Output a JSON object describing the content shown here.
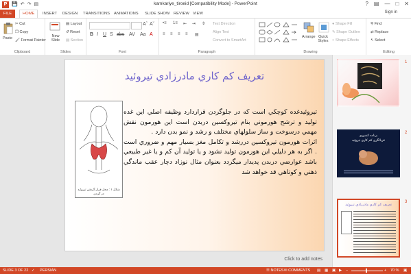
{
  "window": {
    "title": "kamkariye_tiroeid [Compatibility Mode] - PowerPoint"
  },
  "tabs": [
    "FILE",
    "HOME",
    "INSERT",
    "DESIGN",
    "TRANSITIONS",
    "ANIMATIONS",
    "SLIDE SHOW",
    "REVIEW",
    "VIEW"
  ],
  "account": {
    "sign_in": "Sign in"
  },
  "ribbon": {
    "clipboard": {
      "paste": "Paste",
      "cut": "Cut",
      "copy": "Copy",
      "format_painter": "Format Painter",
      "label": "Clipboard"
    },
    "slides": {
      "new_slide": "New Slide",
      "layout": "Layout",
      "reset": "Reset",
      "section": "Section",
      "label": "Slides"
    },
    "font": {
      "label": "Font"
    },
    "paragraph": {
      "text_direction": "Text Direction",
      "align_text": "Align Text",
      "convert_smartart": "Convert to SmartArt",
      "label": "Paragraph"
    },
    "drawing": {
      "arrange": "Arrange",
      "quick_styles": "Quick Styles",
      "shape_fill": "Shape Fill",
      "shape_outline": "Shape Outline",
      "shape_effects": "Shape Effects",
      "label": "Drawing"
    },
    "editing": {
      "find": "Find",
      "replace": "Replace",
      "select": "Select",
      "label": "Editing"
    }
  },
  "slide": {
    "title": "تعريف كم كاري مادرزادي تيروئيد",
    "para1": "تيروئيدغده كوچكي است كه در جلوگردن قراردارد وظيفه اصلي اين غده توليد و ترشح هورموني بنام تيروكسين دربدن است اين هورمون نقش مهمي درسوخت و ساز سلولهاي مختلف و رشد و نمو بدن دارد .",
    "para2": "اثرات هورمون تيروكسين دررشد و تكامل مغز بسيار مهم و ضروري است . اگر به هر دليلي اين هورمون توليد نشود و يا توليد آن كم و يا غير طبيعي باشد عوارضي دربدن پديدار ميگردد بعنوان مثال نوزاد دچار عقب ماندگي ذهني و كوتاهي قد خواهد شد",
    "figure_caption": "شكل ١ : محل قرار گرفتن تيروئيد در گردن"
  },
  "notes_placeholder": "Click to add notes",
  "thumbnails": [
    {
      "number": "1",
      "selected": false
    },
    {
      "number": "2",
      "selected": false,
      "line1": "برنامه كشوري",
      "line2": "غربالگري كم كاري تيروئيد"
    },
    {
      "number": "3",
      "selected": true,
      "title": "تعريف كم كاري مادرزادي تيروئيد"
    }
  ],
  "status": {
    "slide": "SLIDE 3 OF 22",
    "language": "PERSIAN",
    "notes": "NOTES",
    "comments": "COMMENTS",
    "zoom": "70 %"
  },
  "colors": {
    "accent": "#d24726",
    "title_purple": "#6f64cc"
  }
}
